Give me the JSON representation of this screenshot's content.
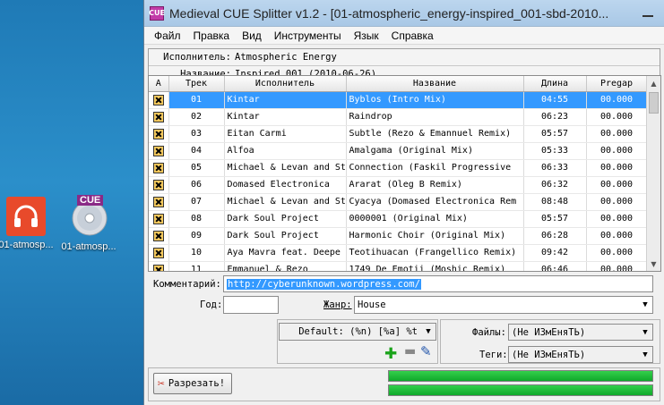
{
  "desktop": {
    "icons": [
      {
        "label": "01-atmosp..."
      },
      {
        "label": "01-atmosp...",
        "badge": "CUE"
      }
    ]
  },
  "window": {
    "title": "Medieval CUE Splitter v1.2 - [01-atmospheric_energy-inspired_001-sbd-2010...",
    "app_icon_text": "CUE"
  },
  "menu": [
    "Файл",
    "Правка",
    "Вид",
    "Инструменты",
    "Язык",
    "Справка"
  ],
  "info": {
    "performer_label": "Исполнитель:",
    "performer": "Atmospheric Energy",
    "title_label": "Название:",
    "title": "Inspired 001 (2010-06-26)"
  },
  "table": {
    "columns": [
      "A",
      "Трек",
      "Исполнитель",
      "Название",
      "Длина",
      "Pregap"
    ],
    "rows": [
      {
        "track": "01",
        "artist": "Kintar",
        "title": "Byblos (Intro Mix)",
        "length": "04:55",
        "pregap": "00.000",
        "selected": true
      },
      {
        "track": "02",
        "artist": "Kintar",
        "title": "Raindrop",
        "length": "06:23",
        "pregap": "00.000"
      },
      {
        "track": "03",
        "artist": "Eitan Carmi",
        "title": "Subtle (Rezo & Emannuel Remix)",
        "length": "05:57",
        "pregap": "00.000"
      },
      {
        "track": "04",
        "artist": "Alfoa",
        "title": "Amalgama (Original Mix)",
        "length": "05:33",
        "pregap": "00.000"
      },
      {
        "track": "05",
        "artist": "Michael & Levan and St",
        "title": "Connection (Faskil Progressive",
        "length": "06:33",
        "pregap": "00.000"
      },
      {
        "track": "06",
        "artist": "Domased Electronica",
        "title": "Ararat (Oleg B Remix)",
        "length": "06:32",
        "pregap": "00.000"
      },
      {
        "track": "07",
        "artist": "Michael & Levan and St",
        "title": "Cyacya (Domased Electronica Rem",
        "length": "08:48",
        "pregap": "00.000"
      },
      {
        "track": "08",
        "artist": "Dark Soul Project",
        "title": "0000001 (Original Mix)",
        "length": "05:57",
        "pregap": "00.000"
      },
      {
        "track": "09",
        "artist": "Dark Soul Project",
        "title": "Harmonic Choir (Original Mix)",
        "length": "06:28",
        "pregap": "00.000"
      },
      {
        "track": "10",
        "artist": "Aya Mavra feat. Deepe",
        "title": "Teotihuacan (Frangellico Remix)",
        "length": "09:42",
        "pregap": "00.000"
      },
      {
        "track": "11",
        "artist": "Emmanuel & Rezo",
        "title": "1749 De Emotii (Moshic Remix)",
        "length": "06:46",
        "pregap": "00.000"
      }
    ]
  },
  "form": {
    "comment_label": "Комментарий:",
    "comment_value": "http://cyberunknown.wordpress.com/",
    "year_label": "Год:",
    "year_value": "",
    "genre_label": "Жанр:",
    "genre_value": "House"
  },
  "output": {
    "template_value": "Default: (%n) [%a] %t",
    "files_label": "Файлы:",
    "files_value": "(Не ИЗмЕняТЬ)",
    "tags_label": "Теги:",
    "tags_value": "(Не ИЗмЕняТЬ)"
  },
  "split_button_label": "Разрезать!",
  "progress": [
    1.0,
    1.0
  ]
}
